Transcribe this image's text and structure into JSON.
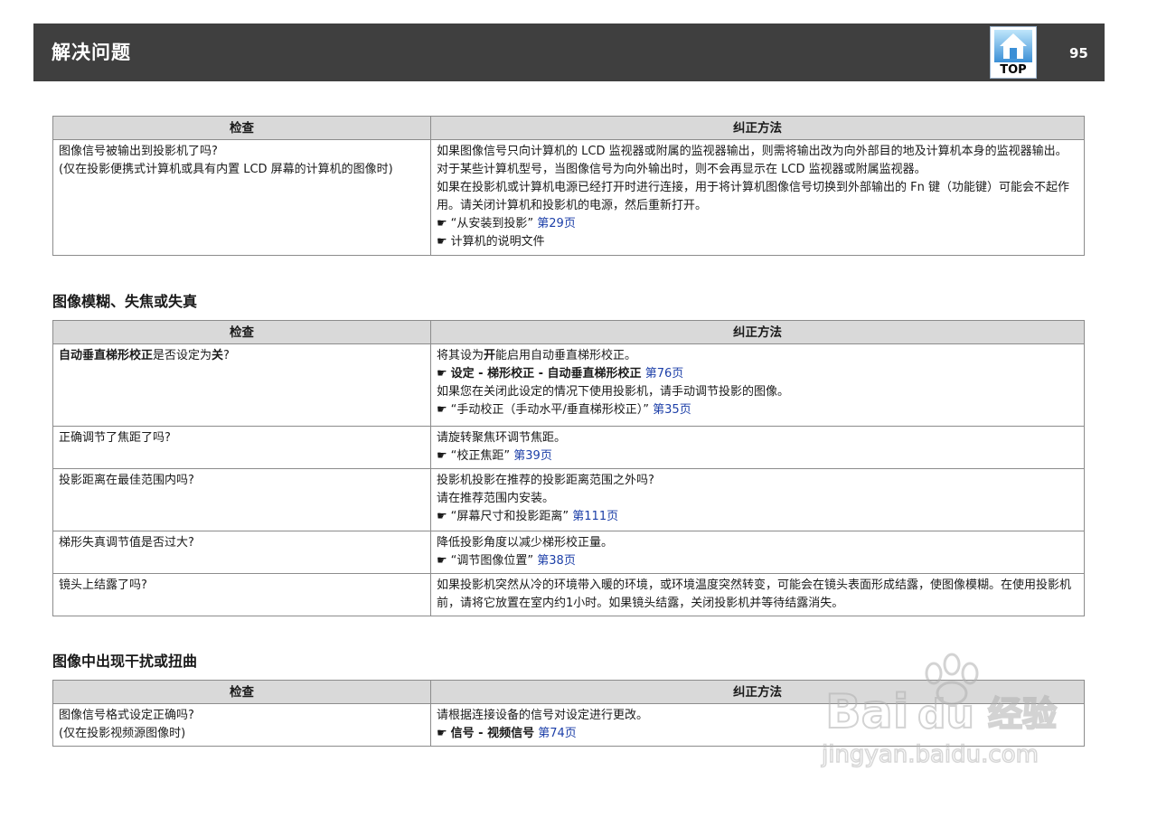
{
  "header": {
    "title": "解决问题",
    "top_label": "TOP",
    "page_number": "95"
  },
  "col_check": "检查",
  "col_fix": "纠正方法",
  "table1": {
    "rows": [
      {
        "check": [
          "图像信号被输出到投影机了吗?",
          "(仅在投影便携式计算机或具有内置 LCD 屏幕的计算机的图像时)"
        ],
        "fix": {
          "p1": "如果图像信号只向计算机的 LCD 监视器或附属的监视器输出，则需将输出改为向外部目的地及计算机本身的监视器输出。对于某些计算机型号，当图像信号为向外输出时，则不会再显示在 LCD 监视器或附属监视器。",
          "p2": "如果在投影机或计算机电源已经打开时进行连接，用于将计算机图像信号切换到外部输出的 Fn 键（功能键）可能会不起作用。请关闭计算机和投影机的电源，然后重新打开。",
          "r1_text": "“从安装到投影”",
          "r1_page": "第29页",
          "r2_text": "计算机的说明文件"
        }
      }
    ]
  },
  "section2_title": "图像模糊、失焦或失真",
  "table2": {
    "rows": [
      {
        "check_bold": "自动垂直梯形校正",
        "check_mid": "是否设定为",
        "check_bold2": "关",
        "check_end": "?",
        "fix": {
          "a1": "将其设为",
          "a_bold": "开",
          "a2": "能启用自动垂直梯形校正。",
          "menu": "设定 - 梯形校正 - 自动垂直梯形校正",
          "menu_page": "第76页",
          "p2": "如果您在关闭此设定的情况下使用投影机，请手动调节投影的图像。",
          "r_text": "“手动校正（手动水平/垂直梯形校正）”",
          "r_page": "第35页"
        }
      },
      {
        "check": "正确调节了焦距了吗?",
        "fix": {
          "p1": "请旋转聚焦环调节焦距。",
          "r_text": "“校正焦距”",
          "r_page": "第39页"
        }
      },
      {
        "check": "投影距离在最佳范围内吗?",
        "fix": {
          "p1": "投影机投影在推荐的投影距离范围之外吗?",
          "p2": "请在推荐范围内安装。",
          "r_text": "“屏幕尺寸和投影距离”",
          "r_page": "第111页"
        }
      },
      {
        "check": "梯形失真调节值是否过大?",
        "fix": {
          "p1": "降低投影角度以减少梯形校正量。",
          "r_text": "“调节图像位置”",
          "r_page": "第38页"
        }
      },
      {
        "check": "镜头上结露了吗?",
        "fix": {
          "p1": "如果投影机突然从冷的环境带入暖的环境，或环境温度突然转变，可能会在镜头表面形成结露，使图像模糊。在使用投影机前，请将它放置在室内约1小时。如果镜头结露，关闭投影机并等待结露消失。"
        }
      }
    ]
  },
  "section3_title": "图像中出现干扰或扭曲",
  "table3": {
    "rows": [
      {
        "check": [
          "图像信号格式设定正确吗?",
          "(仅在投影视频源图像时)"
        ],
        "fix": {
          "p1": "请根据连接设备的信号对设定进行更改。",
          "menu": "信号 - 视频信号",
          "menu_page": "第74页"
        }
      }
    ]
  },
  "watermark": {
    "brand": "Bai",
    "brand2": "du",
    "brand3": "经验",
    "url": "jingyan.baidu.com"
  },
  "icons": {
    "reference": "pointing-hand-icon",
    "top": "house-icon"
  }
}
